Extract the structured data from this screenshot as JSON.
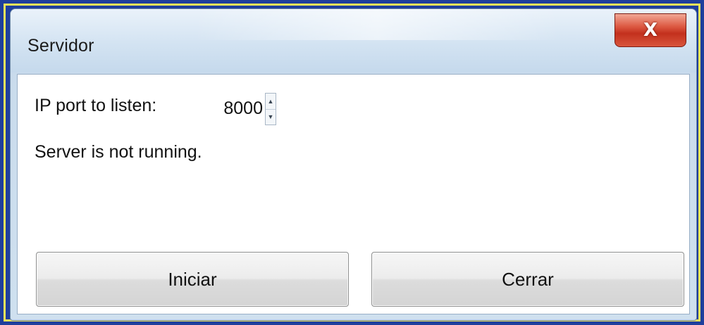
{
  "window": {
    "title": "Servidor",
    "close_label": "X"
  },
  "form": {
    "port_label": "IP port to listen:",
    "port_value": "8000",
    "status_text": "Server is not running."
  },
  "buttons": {
    "start_label": "Iniciar",
    "close_label": "Cerrar"
  },
  "spinner": {
    "up_glyph": "▲",
    "down_glyph": "▼"
  },
  "colors": {
    "frame_blue": "#1f3f9c",
    "frame_yellow": "#f2e35a",
    "close_red": "#c3301d"
  }
}
